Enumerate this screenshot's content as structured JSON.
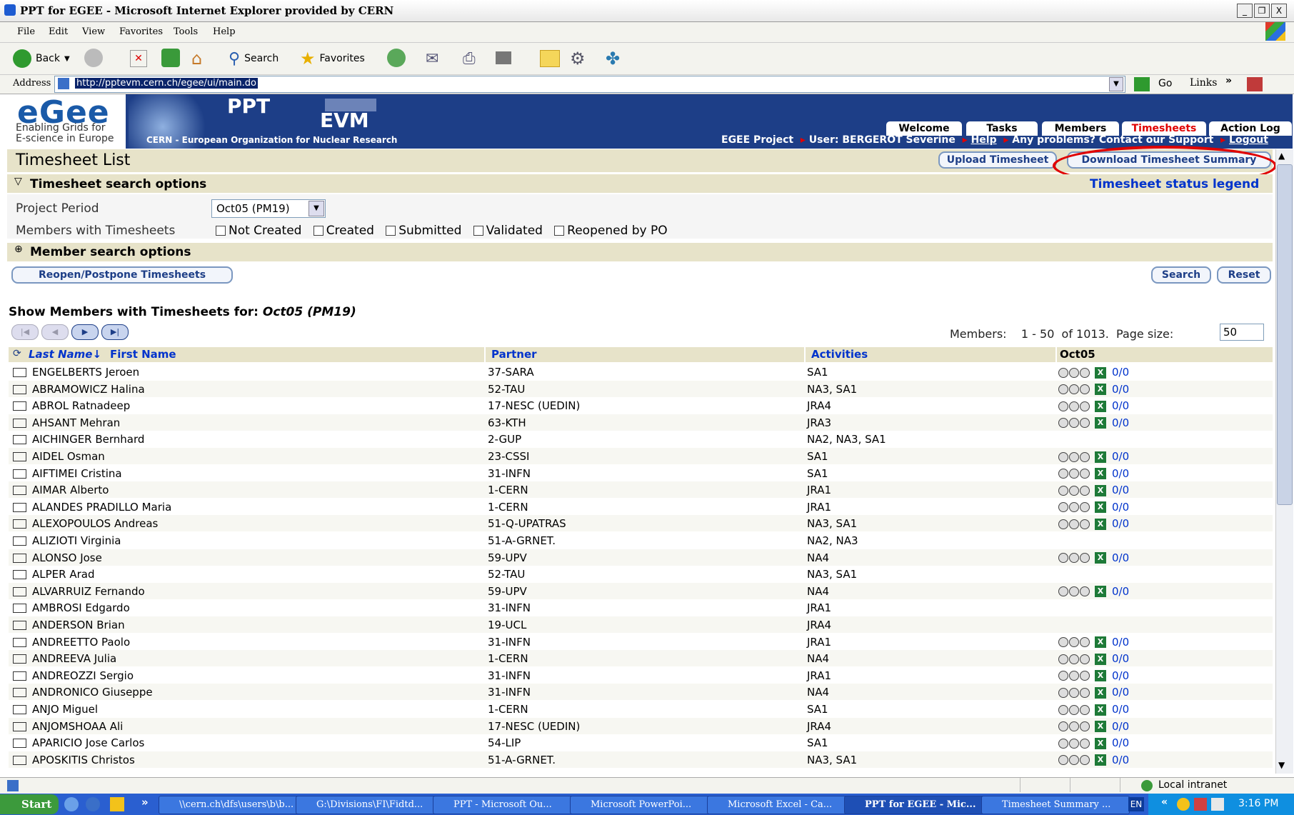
{
  "window": {
    "title": "PPT for EGEE - Microsoft Internet Explorer provided by CERN",
    "controls": [
      "_",
      "❐",
      "X"
    ]
  },
  "menu": [
    "File",
    "Edit",
    "View",
    "Favorites",
    "Tools",
    "Help"
  ],
  "toolbar": {
    "back": "Back",
    "search": "Search",
    "favorites": "Favorites"
  },
  "address": {
    "label": "Address",
    "url": "http://pptevm.cern.ch/egee/ui/main.do",
    "go": "Go",
    "links": "Links"
  },
  "banner": {
    "logo": "eGee",
    "logo_sub1": "Enabling Grids for",
    "logo_sub2": "E-science in Europe",
    "ppt": "PPT",
    "evm": "EVM",
    "cern": "CERN - European Organization for Nuclear Research",
    "tabs": [
      "Welcome",
      "Tasks",
      "Members",
      "Timesheets",
      "Action Log"
    ],
    "active_tab": "Timesheets",
    "project": "EGEE Project",
    "user": "User: BERGEROT Severine",
    "help": "Help",
    "problems": "Any problems? Contact our Support",
    "logout": "Logout"
  },
  "page": {
    "title": "Timesheet List",
    "upload_button": "Upload Timesheet",
    "download_button": "Download Timesheet Summary",
    "search_options_header": "Timesheet search options",
    "status_legend": "Timesheet status legend",
    "project_period_label": "Project Period",
    "project_period_value": "Oct05 (PM19)",
    "members_label": "Members with Timesheets",
    "checkboxes": [
      "Not Created",
      "Created",
      "Submitted",
      "Validated",
      "Reopened by PO"
    ],
    "member_search_header": "Member search options",
    "reopen_button": "Reopen/Postpone Timesheets",
    "search_button": "Search",
    "reset_button": "Reset",
    "show_label": "Show Members with Timesheets for:",
    "show_period": "Oct05 (PM19)",
    "members_count_label": "Members:",
    "members_range": "1 - 50",
    "members_total": "of 1013.",
    "page_size_label": "Page size:",
    "page_size_value": "50"
  },
  "table": {
    "headers": {
      "last_name": "Last Name↓",
      "first_name": "First Name",
      "partner": "Partner",
      "activities": "Activities",
      "period": "Oct05"
    },
    "rows": [
      {
        "name": "ENGELBERTS Jeroen",
        "partner": "37-SARA",
        "activities": "SA1",
        "ratio": "0/0"
      },
      {
        "name": "ABRAMOWICZ Halina",
        "partner": "52-TAU",
        "activities": "NA3, SA1",
        "ratio": "0/0"
      },
      {
        "name": "ABROL Ratnadeep",
        "partner": "17-NESC (UEDIN)",
        "activities": "JRA4",
        "ratio": "0/0"
      },
      {
        "name": "AHSANT Mehran",
        "partner": "63-KTH",
        "activities": "JRA3",
        "ratio": "0/0"
      },
      {
        "name": "AICHINGER Bernhard",
        "partner": "2-GUP",
        "activities": "NA2, NA3, SA1",
        "ratio": ""
      },
      {
        "name": "AIDEL Osman",
        "partner": "23-CSSI",
        "activities": "SA1",
        "ratio": "0/0"
      },
      {
        "name": "AIFTIMEI Cristina",
        "partner": "31-INFN",
        "activities": "SA1",
        "ratio": "0/0"
      },
      {
        "name": "AIMAR Alberto",
        "partner": "1-CERN",
        "activities": "JRA1",
        "ratio": "0/0"
      },
      {
        "name": "ALANDES PRADILLO Maria",
        "partner": "1-CERN",
        "activities": "JRA1",
        "ratio": "0/0"
      },
      {
        "name": "ALEXOPOULOS Andreas",
        "partner": "51-Q-UPATRAS",
        "activities": "NA3, SA1",
        "ratio": "0/0"
      },
      {
        "name": "ALIZIOTI Virginia",
        "partner": "51-A-GRNET.",
        "activities": "NA2, NA3",
        "ratio": ""
      },
      {
        "name": "ALONSO Jose",
        "partner": "59-UPV",
        "activities": "NA4",
        "ratio": "0/0"
      },
      {
        "name": "ALPER Arad",
        "partner": "52-TAU",
        "activities": "NA3, SA1",
        "ratio": ""
      },
      {
        "name": "ALVARRUIZ Fernando",
        "partner": "59-UPV",
        "activities": "NA4",
        "ratio": "0/0"
      },
      {
        "name": "AMBROSI Edgardo",
        "partner": "31-INFN",
        "activities": "JRA1",
        "ratio": ""
      },
      {
        "name": "ANDERSON Brian",
        "partner": "19-UCL",
        "activities": "JRA4",
        "ratio": ""
      },
      {
        "name": "ANDREETTO Paolo",
        "partner": "31-INFN",
        "activities": "JRA1",
        "ratio": "0/0"
      },
      {
        "name": "ANDREEVA Julia",
        "partner": "1-CERN",
        "activities": "NA4",
        "ratio": "0/0"
      },
      {
        "name": "ANDREOZZI Sergio",
        "partner": "31-INFN",
        "activities": "JRA1",
        "ratio": "0/0"
      },
      {
        "name": "ANDRONICO Giuseppe",
        "partner": "31-INFN",
        "activities": "NA4",
        "ratio": "0/0"
      },
      {
        "name": "ANJO Miguel",
        "partner": "1-CERN",
        "activities": "SA1",
        "ratio": "0/0"
      },
      {
        "name": "ANJOMSHOAA Ali",
        "partner": "17-NESC (UEDIN)",
        "activities": "JRA4",
        "ratio": "0/0"
      },
      {
        "name": "APARICIO Jose Carlos",
        "partner": "54-LIP",
        "activities": "SA1",
        "ratio": "0/0"
      },
      {
        "name": "APOSKITIS Christos",
        "partner": "51-A-GRNET.",
        "activities": "NA3, SA1",
        "ratio": "0/0"
      }
    ]
  },
  "statusbar": {
    "zone": "Local intranet"
  },
  "taskbar": {
    "start": "Start",
    "chevron": "»",
    "tasks": [
      "\\\\cern.ch\\dfs\\users\\b\\b...",
      "G:\\Divisions\\FI\\Fidtd...",
      "PPT - Microsoft Ou...",
      "Microsoft PowerPoi...",
      "Microsoft Excel - Ca...",
      "PPT for EGEE - Mic...",
      "Timesheet Summary ..."
    ],
    "lang": "EN",
    "time": "3:16 PM"
  },
  "colors": {
    "accent_red": "#e00000",
    "banner": "#1d3e87",
    "section_bg": "#e7e3c9",
    "link": "#0033cc"
  }
}
